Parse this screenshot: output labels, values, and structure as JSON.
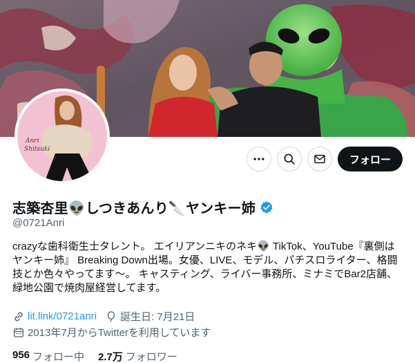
{
  "profile": {
    "display_name": "志築杏里👽しつきあんり🔪ヤンキー姉",
    "handle": "@0721Anri",
    "bio_lines": [
      "crazyな歯科衛生士タレント。 エイリアンニキのネキ👽 TikTok、YouTube『裏側は",
      "ヤンキー姉』 Breaking Down出場。女優、LIVE、モデル、パチスロライター、格闘",
      "技とか色々やってます〜。 キャスティング、ライバー事務所、ミナミでBar2店舗、",
      "緑地公園で焼肉屋経営してます。"
    ],
    "website": "lit.link/0721anri",
    "birthday": "誕生日: 7月21日",
    "joined": "2013年7月からTwitterを利用しています",
    "following_count": "956",
    "following_label": "フォロー中",
    "followers_count": "2.7万",
    "followers_label": "フォロワー",
    "avatar_caption_line1": "Anri",
    "avatar_caption_line2": "Shitsuki"
  },
  "actions": {
    "more_icon": "more-icon",
    "search_icon": "search-icon",
    "message_icon": "message-icon",
    "follow_label": "フォロー"
  },
  "colors": {
    "accent": "#1d9bf0",
    "text_primary": "#0f1419",
    "text_secondary": "#536471",
    "follow_button_bg": "#0f1419",
    "border": "#cfd9de"
  }
}
